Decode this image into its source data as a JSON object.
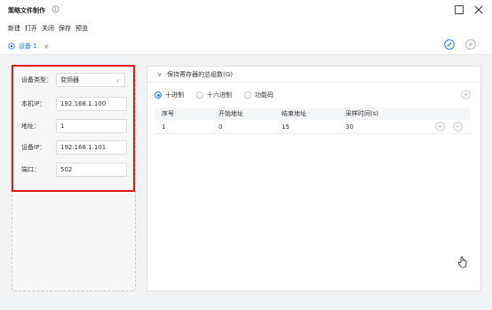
{
  "window": {
    "title": "策略文件制作",
    "info_icon": "info-circle-icon"
  },
  "menu": [
    "新建",
    "打开",
    "关闭",
    "保存",
    "预览"
  ],
  "tab": {
    "label": "设备 1",
    "icon": "device-gear-icon"
  },
  "form": {
    "device_type": {
      "label": "设备类型：",
      "value": "变频器"
    },
    "local_ip": {
      "label": "本机IP：",
      "value": "192.168.1.100"
    },
    "address": {
      "label": "地址：",
      "value": "1"
    },
    "device_ip": {
      "label": "设备IP：",
      "value": "192.168.1.101"
    },
    "port": {
      "label": "端口：",
      "value": "502"
    }
  },
  "registers": {
    "title": "保持寄存器的总组数(G)",
    "radios": [
      {
        "label": "十进制",
        "selected": true
      },
      {
        "label": "十六进制",
        "selected": false
      },
      {
        "label": "功能码",
        "selected": false
      }
    ],
    "columns": [
      "序号",
      "开始地址",
      "结束地址",
      "采样时间(s)"
    ],
    "rows": [
      [
        "1",
        "0",
        "15",
        "30"
      ]
    ]
  },
  "colors": {
    "accent": "#1677ff",
    "highlight": "#e81818",
    "background": "#f2f3f5"
  }
}
